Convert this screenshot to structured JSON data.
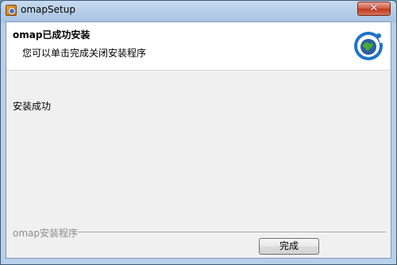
{
  "window": {
    "title": "omapSetup",
    "close_glyph": "✕"
  },
  "header": {
    "title": "omap已成功安装",
    "subtitle": "您可以单击完成关闭安装程序",
    "logo_icon": "globe-logo-icon"
  },
  "main": {
    "status_text": "安装成功"
  },
  "footer": {
    "brand_text": "omap安装程序",
    "finish_label": "完成"
  },
  "colors": {
    "close_button": "#c0391f",
    "logo_blue": "#1e74c8"
  }
}
